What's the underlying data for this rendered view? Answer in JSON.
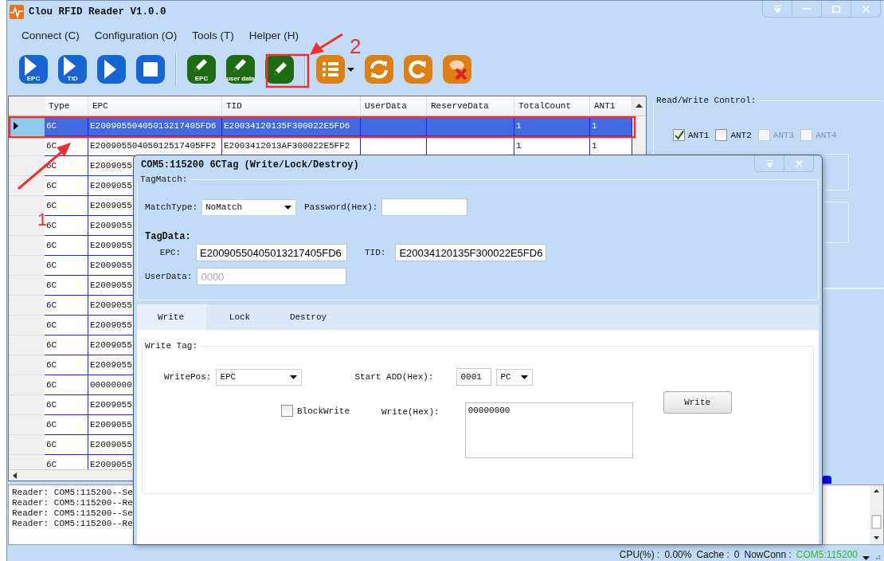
{
  "window": {
    "title": "Clou RFID Reader V1.0.0"
  },
  "menu": [
    {
      "label": "Connect (C)"
    },
    {
      "label": "Configuration (O)"
    },
    {
      "label": "Tools (T)"
    },
    {
      "label": "Helper (H)"
    }
  ],
  "toolbar": [
    {
      "kind": "play",
      "label": "EPC"
    },
    {
      "kind": "play",
      "label": "TID"
    },
    {
      "kind": "play"
    },
    {
      "kind": "stop"
    },
    {
      "kind": "separator"
    },
    {
      "kind": "pencil",
      "label": "EPC"
    },
    {
      "kind": "pencil",
      "label": "user data"
    },
    {
      "kind": "pencil"
    },
    {
      "kind": "separator"
    },
    {
      "kind": "list"
    },
    {
      "kind": "refresh"
    },
    {
      "kind": "reload"
    },
    {
      "kind": "clear"
    }
  ],
  "table": {
    "columns": [
      "Type",
      "EPC",
      "TID",
      "UserData",
      "ReserveData",
      "TotalCount",
      "ANT1"
    ],
    "rows": [
      {
        "selected": true,
        "type": "6C",
        "epc": "E20090550405013217405FD6",
        "tid": "E20034120135F300022E5FD6",
        "total_count": "1",
        "ant1": "1"
      },
      {
        "selected": false,
        "type": "6C",
        "epc": "E20090550405012517405FF2",
        "tid": "E2003412013AF300022E5FF2",
        "total_count": "1",
        "ant1": "1"
      },
      {
        "selected": false,
        "type": "6C",
        "epc": "E2009055"
      },
      {
        "selected": false,
        "type": "6C",
        "epc": "E2009055"
      },
      {
        "selected": false,
        "type": "6C",
        "epc": "E2009055"
      },
      {
        "selected": false,
        "type": "6C",
        "epc": "E2009055"
      },
      {
        "selected": false,
        "type": "6C",
        "epc": "E2009055"
      },
      {
        "selected": false,
        "type": "6C",
        "epc": "E2009055"
      },
      {
        "selected": false,
        "type": "6C",
        "epc": "E2009055"
      },
      {
        "selected": false,
        "type": "6C",
        "epc": "E2009055"
      },
      {
        "selected": false,
        "type": "6C",
        "epc": "E2009055"
      },
      {
        "selected": false,
        "type": "6C",
        "epc": "E2009055"
      },
      {
        "selected": false,
        "type": "6C",
        "epc": "E2009055"
      },
      {
        "selected": false,
        "type": "6C",
        "epc": "00000000"
      },
      {
        "selected": false,
        "type": "6C",
        "epc": "E2009055"
      },
      {
        "selected": false,
        "type": "6C",
        "epc": "E2009055"
      },
      {
        "selected": false,
        "type": "6C",
        "epc": "E2009055"
      },
      {
        "selected": false,
        "type": "6C",
        "epc": "E2009055"
      }
    ]
  },
  "read_write_control": {
    "legend": "Read/Write Control:",
    "antennas": [
      {
        "label": "ANT1",
        "checked": true,
        "disabled": false
      },
      {
        "label": "ANT2",
        "checked": false,
        "disabled": false
      },
      {
        "label": "ANT3",
        "checked": false,
        "disabled": true
      },
      {
        "label": "ANT4",
        "checked": false,
        "disabled": true
      }
    ]
  },
  "log": [
    "Reader: COM5:115200--Se",
    "Reader: COM5:115200--Re",
    "Reader: COM5:115200--Se",
    "Reader: COM5:115200--Re"
  ],
  "status_bar": {
    "cpu_label": "CPU(%) :",
    "cpu": "0.00%",
    "cache_label": "Cache :",
    "cache": "0",
    "conn_label": "NowConn :",
    "conn": "COM5:115200"
  },
  "dialog": {
    "title": "COM5:115200 6CTag (Write/Lock/Destroy)",
    "tag_match": {
      "legend": "TagMatch:",
      "match_type_label": "MatchType:",
      "match_type": "NoMatch",
      "password_label": "Password(Hex):"
    },
    "tag_data": {
      "heading": "TagData:",
      "epc_label": "EPC:",
      "epc": "E20090550405013217405FD6",
      "tid_label": "TID:",
      "tid": "E20034120135F300022E5FD6",
      "user_data_label": "UserData:",
      "user_data_placeholder": "0000"
    },
    "tabs": [
      {
        "label": "Write",
        "selected": true
      },
      {
        "label": "Lock",
        "selected": false
      },
      {
        "label": "Destroy",
        "selected": false
      }
    ],
    "write_tag": {
      "legend": "Write Tag:",
      "write_pos_label": "WritePos:",
      "write_pos": "EPC",
      "start_add_label": "Start ADD(Hex):",
      "start_add": "0001",
      "start_bank": "PC",
      "block_write": {
        "label": "BlockWrite",
        "checked": false
      },
      "write_hex_label": "Write(Hex):",
      "write_hex": "00000000",
      "button": "Write"
    }
  },
  "annotations": [
    {
      "label": "1"
    },
    {
      "label": "2"
    }
  ]
}
